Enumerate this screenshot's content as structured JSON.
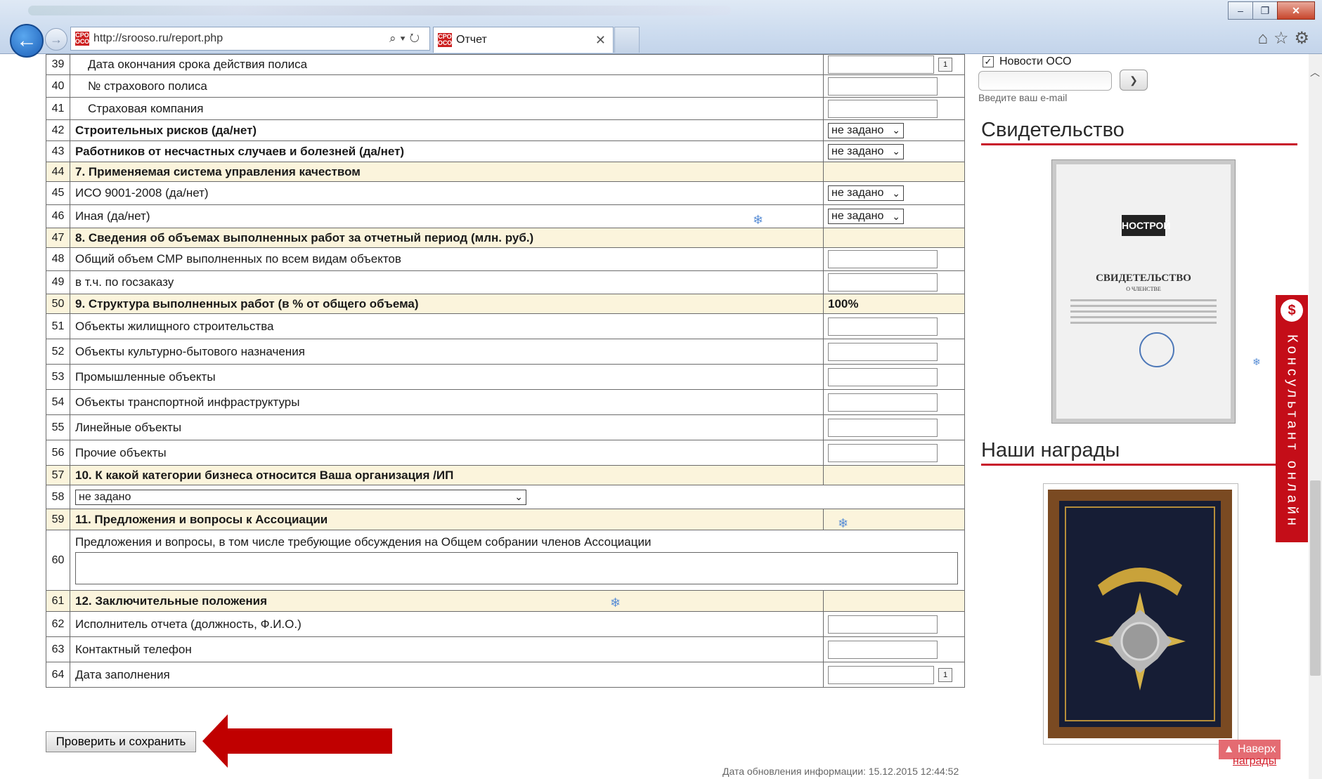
{
  "browser": {
    "url": "http://srooso.ru/report.php",
    "tab_title": "Отчет",
    "favicon_text": "СРО ОСО"
  },
  "rows": [
    {
      "num": "39",
      "label": "Дата окончания срока действия полиса",
      "control": "date",
      "indent": true,
      "cal": "1"
    },
    {
      "num": "40",
      "label": "№ страхового полиса",
      "control": "text",
      "indent": true
    },
    {
      "num": "41",
      "label": "Страховая компания",
      "control": "text",
      "indent": true
    },
    {
      "num": "42",
      "label": "Строительных рисков (да/нет)",
      "control": "select",
      "bold": true,
      "value": "не задано"
    },
    {
      "num": "43",
      "label": "Работников от несчастных случаев и болезней (да/нет)",
      "control": "select",
      "bold": true,
      "value": "не задано"
    },
    {
      "num": "44",
      "label": "7. Применяемая система управления качеством",
      "section": true
    },
    {
      "num": "45",
      "label": "ИСО 9001-2008 (да/нет)",
      "control": "select",
      "value": "не задано"
    },
    {
      "num": "46",
      "label": "Иная (да/нет)",
      "control": "select",
      "value": "не задано"
    },
    {
      "num": "47",
      "label": "8. Сведения об объемах выполненных работ за отчетный период (млн. руб.)",
      "section": true
    },
    {
      "num": "48",
      "label": "Общий объем СМР выполненных по всем видам объектов",
      "control": "text"
    },
    {
      "num": "49",
      "label": "в т.ч. по госзаказу",
      "control": "text"
    },
    {
      "num": "50",
      "label": "9. Структура выполненных работ (в % от общего объема)",
      "section": true,
      "total": "100%"
    },
    {
      "num": "51",
      "label": "Объекты жилищного строительства",
      "control": "text"
    },
    {
      "num": "52",
      "label": "Объекты культурно-бытового назначения",
      "control": "text"
    },
    {
      "num": "53",
      "label": "Промышленные объекты",
      "control": "text"
    },
    {
      "num": "54",
      "label": "Объекты транспортной инфраструктуры",
      "control": "text"
    },
    {
      "num": "55",
      "label": "Линейные объекты",
      "control": "text"
    },
    {
      "num": "56",
      "label": "Прочие объекты",
      "control": "text"
    },
    {
      "num": "57",
      "label": "10. К какой категории бизнеса относится Ваша организация /ИП",
      "section": true
    },
    {
      "num": "58",
      "control": "wideselect",
      "value": "не задано"
    },
    {
      "num": "59",
      "label": "11. Предложения и вопросы к Ассоциации",
      "section": true
    },
    {
      "num": "60",
      "label": "Предложения и вопросы, в том числе требующие обсуждения на Общем собрании членов Ассоциации",
      "control": "textarea"
    },
    {
      "num": "61",
      "label": "12. Заключительные положения",
      "section": true
    },
    {
      "num": "62",
      "label": "Исполнитель отчета (должность, Ф.И.О.)",
      "control": "text"
    },
    {
      "num": "63",
      "label": "Контактный телефон",
      "control": "text"
    },
    {
      "num": "64",
      "label": "Дата заполнения",
      "control": "date",
      "cal": "1"
    }
  ],
  "submit_label": "Проверить и сохранить",
  "updated_text": "Дата обновления информации: 15.12.2015 12:44:52",
  "sidebar": {
    "news_label": "Новости ОСО",
    "email_hint": "Введите ваш e-mail",
    "certificate_heading": "Свидетельство",
    "awards_heading": "Наши награды",
    "consult_label": "Консультант онлайн",
    "to_top_label": "▲ Наверх",
    "awards_link": "награды",
    "certificate": {
      "logo": "НОСТРОЙ",
      "title": "СВИДЕТЕЛЬСТВО",
      "subtitle": "О ЧЛЕНСТВЕ"
    }
  },
  "colors": {
    "section_bg": "#fbf4dc",
    "accent_red": "#c40d18",
    "arrow_red": "#c00000"
  }
}
